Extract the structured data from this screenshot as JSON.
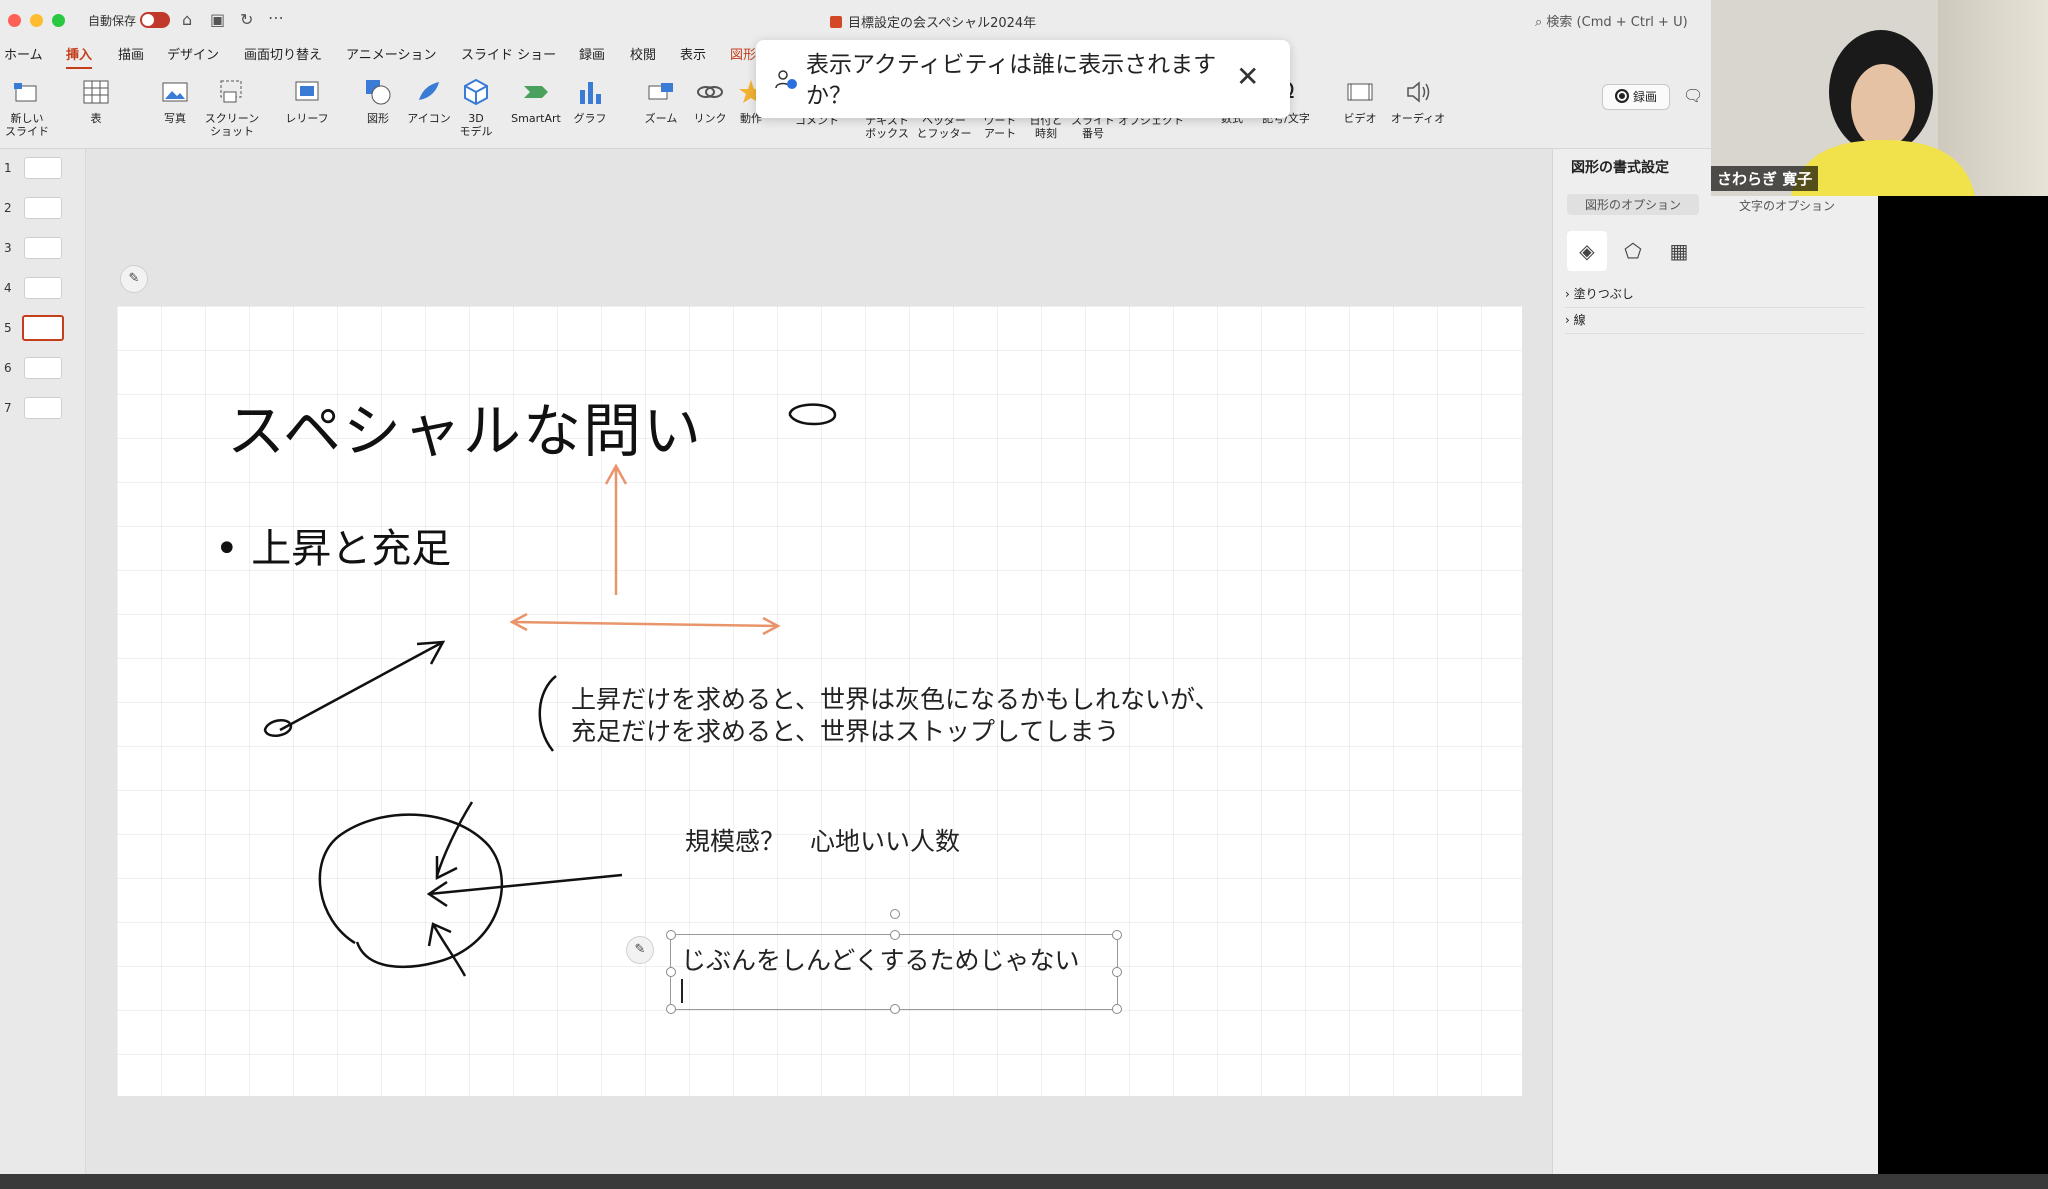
{
  "window": {
    "autosave_label": "自動保存",
    "doc_title": "目標設定の会スペシャル2024年",
    "search_placeholder": "検索 (Cmd + Ctrl + U)"
  },
  "tabs": [
    "ホーム",
    "挿入",
    "描画",
    "デザイン",
    "画面切り替え",
    "アニメーション",
    "スライド ショー",
    "録画",
    "校閲",
    "表示",
    "図形"
  ],
  "active_tab": "挿入",
  "record_label": "録画",
  "ribbon": {
    "new_slide": "新しい\nスライド",
    "table": "表",
    "photo": "写真",
    "screenshot": "スクリーン\nショット",
    "review": "レリーフ",
    "shapes": "図形",
    "icons": "アイコン",
    "model3d": "3D\nモデル",
    "smartart": "SmartArt",
    "chart": "グラフ",
    "zoom": "ズーム",
    "link": "リンク",
    "action": "動作",
    "comment": "コメント",
    "textbox": "テキスト\nボックス",
    "headerfooter": "ヘッダー\nとフッター",
    "wordart": "ワード\nアート",
    "datetime": "日付と\n時刻",
    "slidenum": "スライド\n番号",
    "object": "オブジェクト",
    "equation": "数式",
    "symbol": "記号/文字",
    "video": "ビデオ",
    "audio": "オーディオ"
  },
  "popup": {
    "text": "表示アクティビティは誰に表示されますか？"
  },
  "thumbnails": [
    "1",
    "2",
    "3",
    "4",
    "5",
    "6",
    "7"
  ],
  "selected_slide": 5,
  "slide": {
    "title": "スペシャルな問い",
    "bullet": "• 上昇と充足",
    "line1": "上昇だけを求めると、世界は灰色になるかもしれないが、",
    "line2": "充足だけを求めると、世界はストップしてしまう",
    "scale": "規模感？　心地いい人数",
    "textbox_value": "じぶんをしんどくするためじゃない"
  },
  "right_pane": {
    "title": "図形の書式設定",
    "tab_shape": "図形のオプション",
    "tab_text": "文字のオプション",
    "fill": "塗りつぶし",
    "line": "線"
  },
  "video": {
    "participant": "さわらぎ 寛子"
  },
  "colors": {
    "accent": "#c43e1c",
    "arrow_orange": "#e8956b",
    "toggle": "#c0392b"
  }
}
